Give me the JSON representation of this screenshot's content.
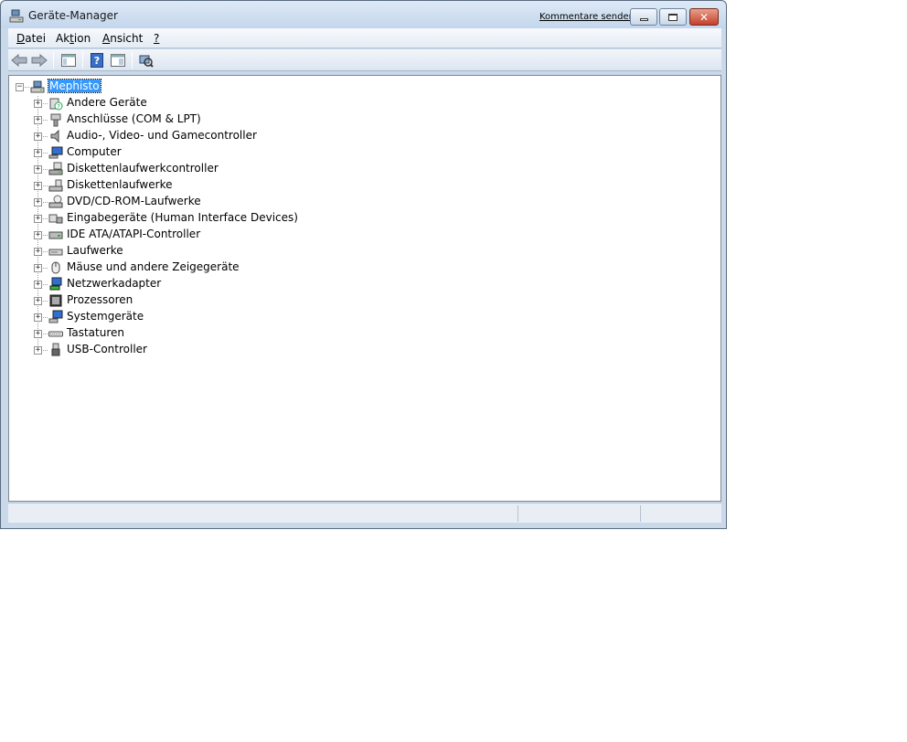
{
  "window": {
    "title": "Geräte-Manager",
    "feedback_link": "Kommentare senden"
  },
  "menubar": {
    "items": [
      {
        "label": "Datei",
        "accel": "D",
        "rest": "atei"
      },
      {
        "label": "Aktion",
        "pre": "Ak",
        "accel": "t",
        "rest": "ion"
      },
      {
        "label": "Ansicht",
        "accel": "A",
        "rest": "nsicht"
      },
      {
        "label": "?",
        "accel": "?",
        "rest": ""
      }
    ]
  },
  "toolbar": {
    "buttons": [
      "back-icon",
      "forward-icon",
      "show-hide-console-tree-icon",
      "help-icon",
      "properties-icon",
      "scan-hardware-icon"
    ]
  },
  "tree": {
    "root": {
      "label": "Mephisto",
      "selected": true,
      "expanded": true,
      "icon": "computer-icon"
    },
    "categories": [
      {
        "label": "Andere Geräte",
        "icon": "unknown-device-icon"
      },
      {
        "label": "Anschlüsse (COM & LPT)",
        "icon": "port-icon"
      },
      {
        "label": "Audio-, Video- und Gamecontroller",
        "icon": "speaker-icon"
      },
      {
        "label": "Computer",
        "icon": "monitor-icon"
      },
      {
        "label": "Diskettenlaufwerkcontroller",
        "icon": "floppy-controller-icon"
      },
      {
        "label": "Diskettenlaufwerke",
        "icon": "floppy-drive-icon"
      },
      {
        "label": "DVD/CD-ROM-Laufwerke",
        "icon": "dvd-drive-icon"
      },
      {
        "label": "Eingabegeräte (Human Interface Devices)",
        "icon": "hid-icon"
      },
      {
        "label": "IDE ATA/ATAPI-Controller",
        "icon": "ide-controller-icon"
      },
      {
        "label": "Laufwerke",
        "icon": "disk-drive-icon"
      },
      {
        "label": "Mäuse und andere Zeigegeräte",
        "icon": "mouse-icon"
      },
      {
        "label": "Netzwerkadapter",
        "icon": "network-adapter-icon"
      },
      {
        "label": "Prozessoren",
        "icon": "processor-icon"
      },
      {
        "label": "Systemgeräte",
        "icon": "system-device-icon"
      },
      {
        "label": "Tastaturen",
        "icon": "keyboard-icon"
      },
      {
        "label": "USB-Controller",
        "icon": "usb-icon"
      }
    ]
  },
  "colors": {
    "selection": "#3399ff",
    "frame": "#c9d9ea",
    "close_button": "#c3412b"
  }
}
